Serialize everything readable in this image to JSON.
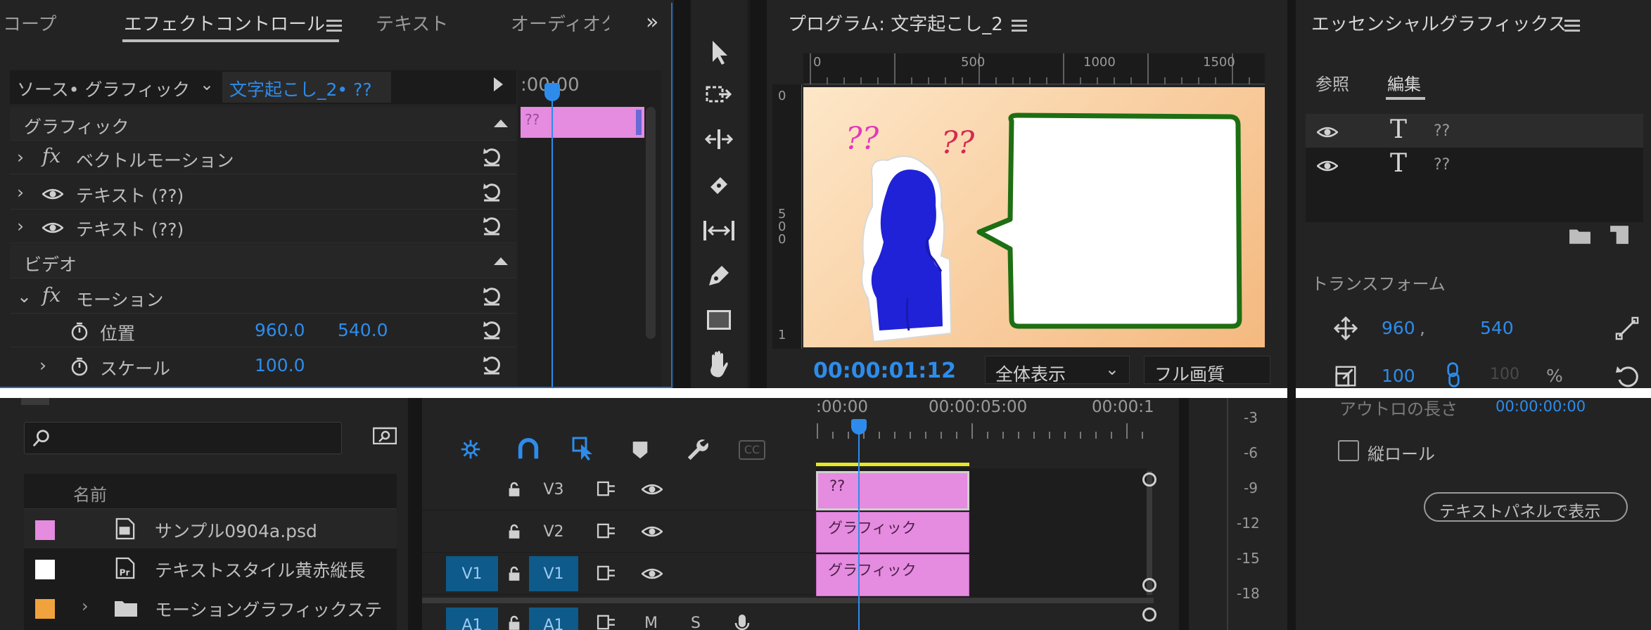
{
  "effect_panel": {
    "tabs": [
      "コープ",
      "エフェクトコントロール",
      "テキスト",
      "オーディオク"
    ],
    "source_label": "ソース• グラフィック",
    "clip_name": "文字起こし_2• ??",
    "timecode": ":00:00",
    "mini_clip_label": "??",
    "sections": {
      "graphic": "グラフィック",
      "video": "ビデオ"
    },
    "rows": {
      "vector_motion": "ベクトルモーション",
      "text1": "テキスト (??)",
      "text2": "テキスト (??)",
      "motion": "モーション",
      "position": "位置",
      "position_x": "960.0",
      "position_y": "540.0",
      "scale": "スケール",
      "scale_value": "100.0"
    }
  },
  "program_monitor": {
    "title": "プログラム: 文字起こし_2",
    "ruler_ticks": [
      "0",
      "500",
      "1000",
      "1500"
    ],
    "vruler_ticks": [
      "0",
      "5\n0\n0",
      "1"
    ],
    "timecode": "00:00:01:12",
    "fit_select": "全体表示",
    "quality_select": "フル画質",
    "question_marks_left": "??",
    "question_marks_right": "??"
  },
  "essential_graphics": {
    "title": "エッセンシャルグラフィックス",
    "tabs": [
      "参照",
      "編集"
    ],
    "layers": [
      {
        "label": "??"
      },
      {
        "label": "??"
      }
    ],
    "transform_label": "トランスフォーム",
    "position_x": "960",
    "position_sep": ",",
    "position_y": "540",
    "scale_value": "100",
    "scale_ghost": "100",
    "percent": "%",
    "outro_label": "アウトロの長さ",
    "outro_value": "00:00:00:00",
    "vertical_roll_label": "縦ロール",
    "show_text_panel_button": "テキストパネルで表示"
  },
  "project_panel": {
    "column_name": "名前",
    "items": [
      {
        "name": "サンプル0904a.psd",
        "color": "#e58be0"
      },
      {
        "name": "テキストスタイル黄赤縦長",
        "color": "#ffffff"
      },
      {
        "name": "モーショングラフィックステ",
        "color": "#f0a33c"
      }
    ]
  },
  "timeline": {
    "ruler_labels": [
      ":00:00",
      "00:00:05:00",
      "00:00:1"
    ],
    "tracks": [
      {
        "name": "V3",
        "clip": "??"
      },
      {
        "name": "V2",
        "clip": "グラフィック"
      },
      {
        "name": "V1",
        "clip": "グラフィック",
        "source_patch": "V1"
      },
      {
        "name": "A1",
        "source_patch": "A1",
        "m": "M",
        "s": "S"
      }
    ]
  },
  "audio_meter": {
    "ticks": [
      "-3",
      "-6",
      "-9",
      "-12",
      "-15",
      "-18"
    ]
  },
  "colors": {
    "accent_blue": "#2d8ceb",
    "clip_pink": "#e58be0",
    "balloon_green": "#1e6e13",
    "figure_blue": "#1f22d6"
  }
}
